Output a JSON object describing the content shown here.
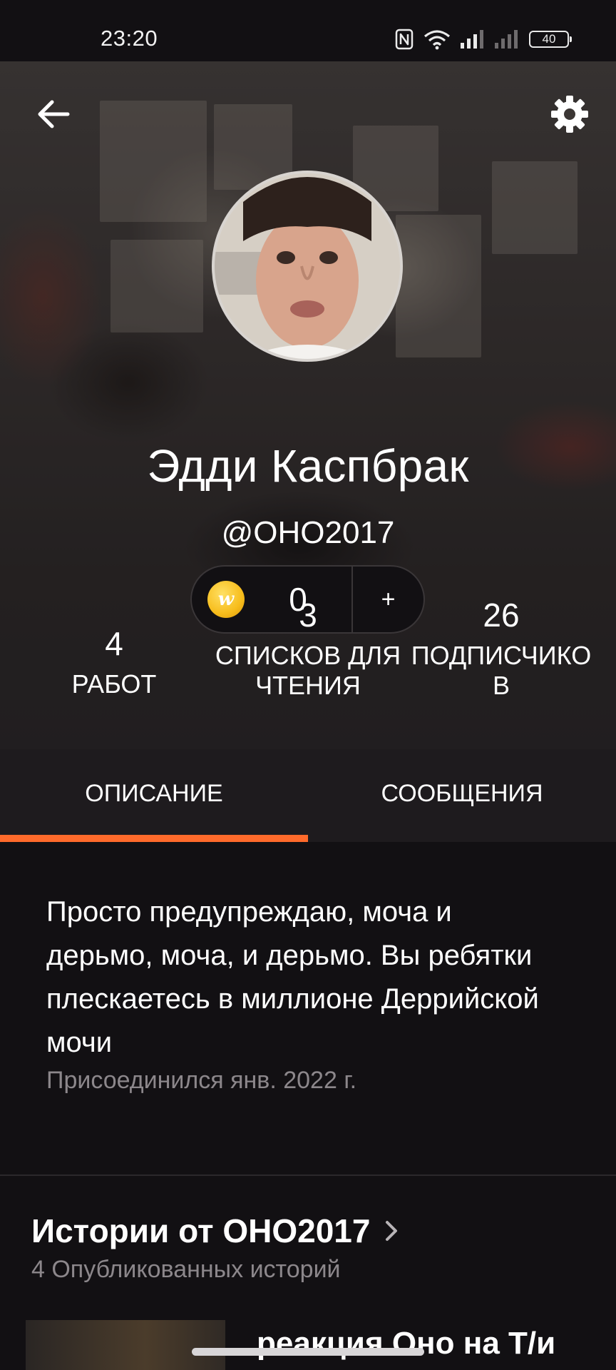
{
  "status_bar": {
    "time": "23:20",
    "battery": "40",
    "icons": [
      "nfc-icon",
      "wifi-icon",
      "signal-icon",
      "signal-icon",
      "battery-icon"
    ]
  },
  "header": {
    "back_icon": "arrow-left-icon",
    "settings_icon": "gear-icon",
    "name": "Эдди Каспбрак",
    "handle": "@OHO2017"
  },
  "coins": {
    "icon": "wattpad-coin-icon",
    "glyph": "w",
    "count": "0",
    "add_label": "+"
  },
  "stats": [
    {
      "value": "4",
      "label": "РАБОТ"
    },
    {
      "value": "3",
      "label_line1": "СПИСКОВ ДЛЯ",
      "label_line2": "ЧТЕНИЯ"
    },
    {
      "value": "26",
      "label_line1": "ПОДПИСЧИКО",
      "label_line2": "В"
    }
  ],
  "tabs": [
    {
      "label": "ОПИСАНИЕ",
      "active": true
    },
    {
      "label": "СООБЩЕНИЯ",
      "active": false
    }
  ],
  "about": {
    "text": "Просто предупреждаю, моча и дерьмо, моча, и дерьмо. Вы ребятки плескаетесь в миллионе Деррийской мочи",
    "joined": "Присоединился янв. 2022 г."
  },
  "stories": {
    "title": "Истории от OHO2017",
    "subtitle": "4 Опубликованных историй",
    "first_story_title": "реакция Оно на Т/и"
  },
  "colors": {
    "accent": "#ff6a2b",
    "background": "#121013",
    "tab_bar": "#1e1b1e",
    "muted_text": "#8c878b"
  }
}
